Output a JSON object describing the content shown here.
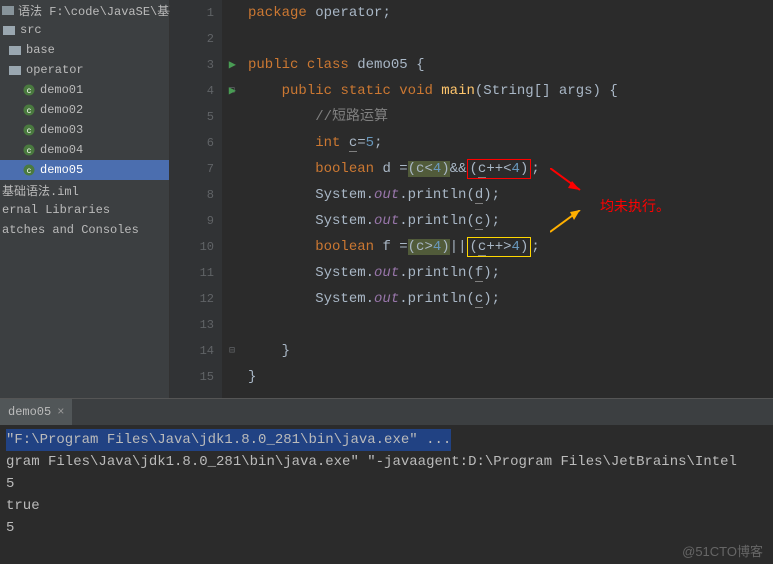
{
  "sidebar": {
    "project_root": "语法  F:\\code\\JavaSE\\基础语法",
    "src_label": "src",
    "folders": {
      "base": "base",
      "operator": "operator"
    },
    "files": {
      "demo01": "demo01",
      "demo02": "demo02",
      "demo03": "demo03",
      "demo04": "demo04",
      "demo05": "demo05"
    },
    "iml": "基础语法.iml",
    "ext_libs": "ernal Libraries",
    "scratches": "atches and Consoles"
  },
  "code": {
    "line1_package": "package",
    "line1_pkg": "operator",
    "line3_public": "public",
    "line3_class": "class",
    "line3_name": "demo05",
    "line4_public": "public",
    "line4_static": "static",
    "line4_void": "void",
    "line4_main": "main",
    "line4_args": "(String[] args) {",
    "line5_comment": "//短路运算",
    "line6_int": "int",
    "line6_var": "c",
    "line6_eq": "=",
    "line6_val": "5",
    "line7_bool": "boolean",
    "line7_var": "d =",
    "line7_exp1": "(c<4)",
    "line7_and": "&&",
    "line7_exp2": "(c++<4)",
    "line8_sys": "System.",
    "line8_out": "out",
    "line8_pr": ".println(",
    "line8_arg": "d",
    "line9_arg": "c",
    "line10_bool": "boolean",
    "line10_var": "f =",
    "line10_exp1": "(c>4)",
    "line10_or": "||",
    "line10_exp2": "(c++>4)",
    "line11_arg": "f",
    "line12_arg": "c",
    "annotation": "均未执行。"
  },
  "gutter": [
    "1",
    "2",
    "3",
    "4",
    "5",
    "6",
    "7",
    "8",
    "9",
    "10",
    "11",
    "12",
    "13",
    "14",
    "15"
  ],
  "console": {
    "tab": "demo05",
    "cmd_hl": "\"F:\\Program Files\\Java\\jdk1.8.0_281\\bin\\java.exe\" ...",
    "full_cmd": "gram Files\\Java\\jdk1.8.0_281\\bin\\java.exe\" \"-javaagent:D:\\Program Files\\JetBrains\\Intel",
    "out1": "5",
    "out2": "true",
    "out3": "5"
  },
  "watermark": "@51CTO博客"
}
